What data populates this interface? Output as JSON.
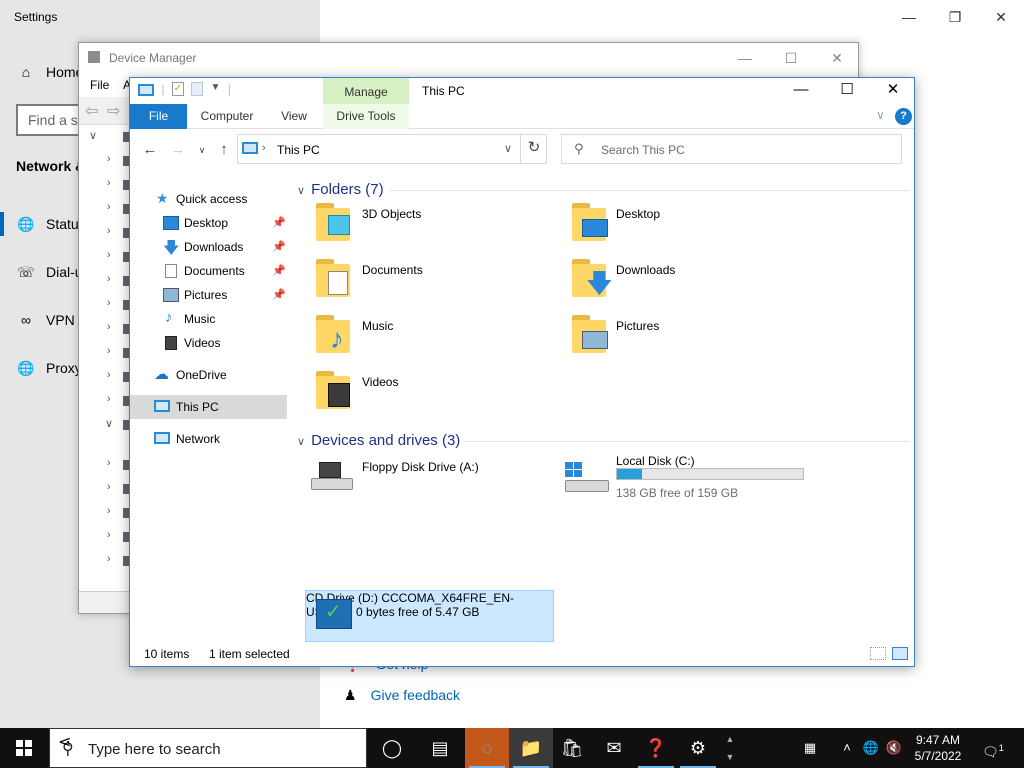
{
  "settings": {
    "title": "Settings",
    "nav": {
      "home": "Home",
      "section": "Network &",
      "status": "Statu",
      "dialup": "Dial-u",
      "vpn": "VPN",
      "proxy": "Proxy"
    },
    "find_placeholder": "Find a se",
    "help_link": "Get help",
    "feedback_link": "Give feedback"
  },
  "device_manager": {
    "title": "Device Manager",
    "menu": {
      "file": "File",
      "action": "A"
    }
  },
  "explorer": {
    "title": "This PC",
    "manage_tab": "Manage",
    "ribbon": {
      "file": "File",
      "computer": "Computer",
      "view": "View",
      "drive_tools": "Drive Tools",
      "help": "?"
    },
    "address": "This PC",
    "search_placeholder": "Search This PC",
    "nav": [
      {
        "label": "Quick access",
        "icon": "star-icon"
      },
      {
        "label": "Desktop",
        "icon": "desktop-icon",
        "pinned": true
      },
      {
        "label": "Downloads",
        "icon": "download-icon",
        "pinned": true
      },
      {
        "label": "Documents",
        "icon": "document-icon",
        "pinned": true
      },
      {
        "label": "Pictures",
        "icon": "picture-icon",
        "pinned": true
      },
      {
        "label": "Music",
        "icon": "music-icon"
      },
      {
        "label": "Videos",
        "icon": "video-icon"
      },
      {
        "label": "OneDrive",
        "icon": "cloud-icon"
      },
      {
        "label": "This PC",
        "icon": "computer-icon",
        "selected": true
      },
      {
        "label": "Network",
        "icon": "network-icon"
      }
    ],
    "folders_header": "Folders (7)",
    "folders": [
      "3D Objects",
      "Desktop",
      "Documents",
      "Downloads",
      "Music",
      "Pictures",
      "Videos"
    ],
    "devices_header": "Devices and drives (3)",
    "drives": {
      "floppy": {
        "name": "Floppy Disk Drive (A:)"
      },
      "local": {
        "name": "Local Disk (C:)",
        "free": "138 GB free of 159 GB",
        "used_fraction": 0.132
      },
      "cd": {
        "name": "CD Drive (D:)",
        "label": "CCCOMA_X64FRE_EN-US_DV9",
        "free": "0 bytes free of 5.47 GB"
      }
    },
    "status": {
      "items": "10 items",
      "selected": "1 item selected"
    }
  },
  "taskbar": {
    "search_placeholder": "Type here to search",
    "time": "9:47 AM",
    "date": "5/7/2022",
    "notification_count": "1",
    "accent": "#76b9ed"
  }
}
